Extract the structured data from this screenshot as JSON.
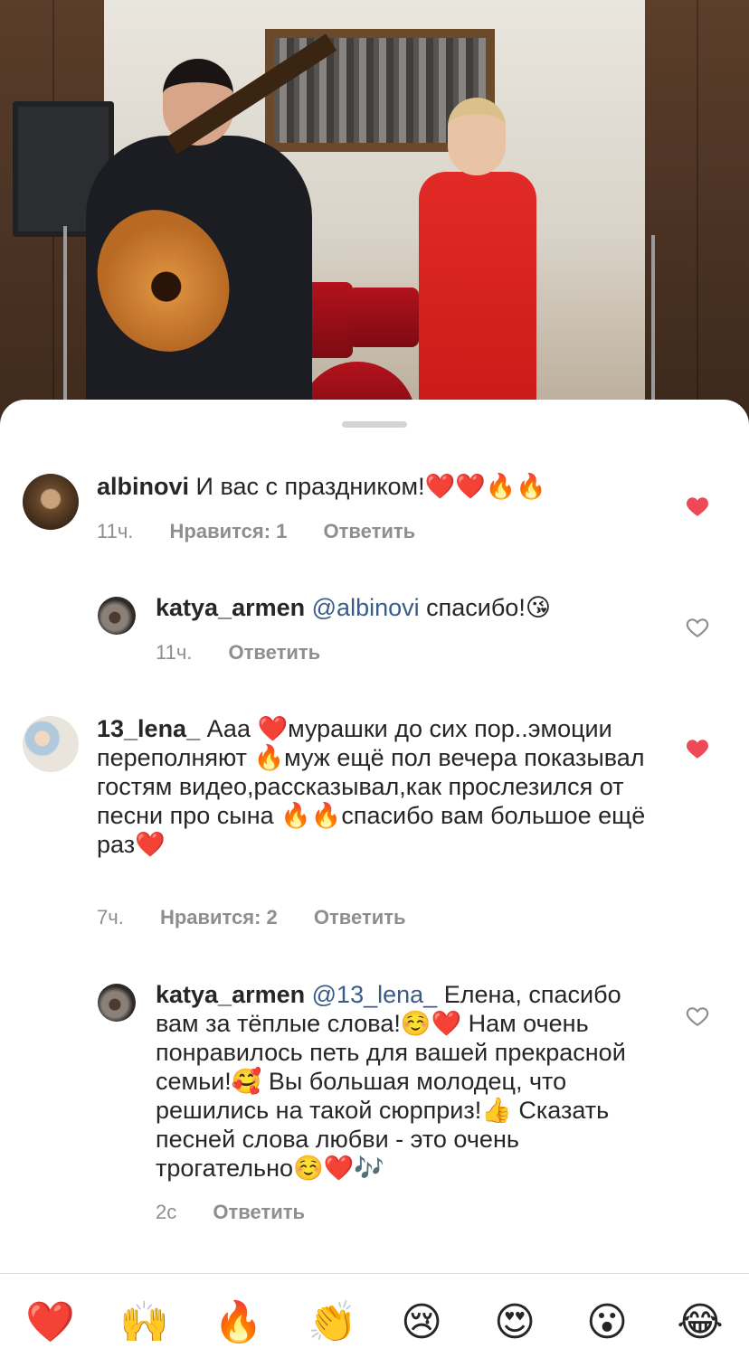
{
  "comments": [
    {
      "username": "albinovi",
      "text": "И вас с праздником!❤️❤️🔥🔥",
      "time": "11ч.",
      "likes": "Нравится: 1",
      "reply": "Ответить",
      "liked": true
    },
    {
      "username": "katya_armen",
      "mention": "@albinovi",
      "text": "спасибо!😘",
      "time": "11ч.",
      "reply": "Ответить",
      "liked": false
    },
    {
      "username": "13_lena_",
      "text": "Ааа ❤️мурашки до сих пор..эмоции переполняют 🔥муж ещё пол вечера показывал гостям видео,рассказывал,как прослезился от песни про сына 🔥🔥спасибо вам большое ещё раз❤️",
      "time": "7ч.",
      "likes": "Нравится: 2",
      "reply": "Ответить",
      "liked": true
    },
    {
      "username": "katya_armen",
      "mention": "@13_lena_",
      "text": "Елена, спасибо вам за тёплые слова!☺️❤️ Нам очень понравилось петь для вашей прекрасной семьи!🥰 Вы большая молодец, что решились на такой сюрприз!👍 Сказать песней слова любви - это очень трогательно☺️❤️🎶",
      "time": "2с",
      "reply": "Ответить",
      "liked": false
    }
  ],
  "reactions": [
    "❤️",
    "🙌",
    "🔥",
    "👏",
    "😢",
    "😍",
    "😮",
    "😂"
  ],
  "colors": {
    "liked_heart": "#ed4956",
    "outline_heart": "#8e8e8e",
    "mention": "#3a5b8a",
    "meta": "#8e8e8e"
  }
}
